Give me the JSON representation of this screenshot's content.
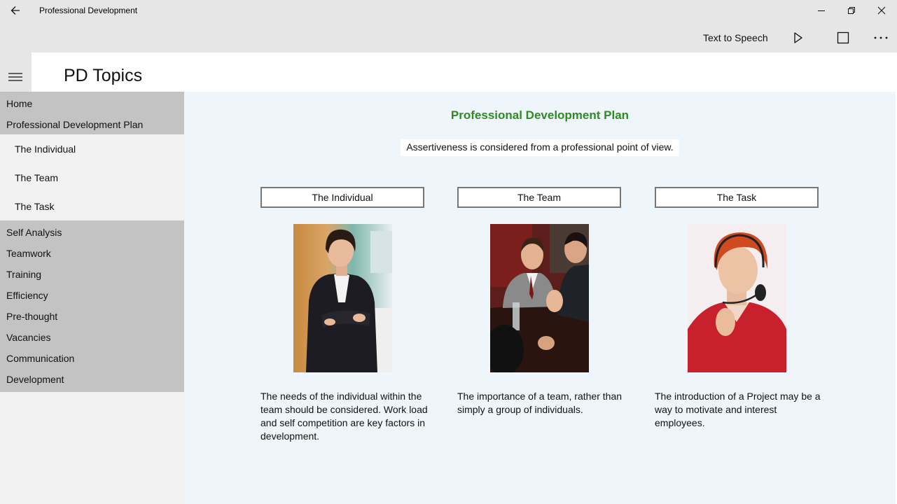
{
  "window": {
    "title": "Professional Development"
  },
  "commandbar": {
    "tts_label": "Text to Speech"
  },
  "header": {
    "page_title": "PD Topics"
  },
  "sidebar": {
    "top_items": [
      "Home",
      "Professional Development Plan"
    ],
    "sub_items": [
      "The Individual",
      "The Team",
      "The Task"
    ],
    "bottom_items": [
      "Self Analysis",
      "Teamwork",
      "Training",
      "Efficiency",
      "Pre-thought",
      "Vacancies",
      "Communication",
      "Development"
    ]
  },
  "main": {
    "title": "Professional Development Plan",
    "subtitle": "Assertiveness is considered from a professional point of view.",
    "topics": [
      {
        "button_label": "The Individual",
        "description": "The needs of the individual within the team should be considered. Work load and self competition are key factors in development."
      },
      {
        "button_label": "The Team",
        "description": "The importance of a team, rather than simply a group of individuals."
      },
      {
        "button_label": "The Task",
        "description": "The introduction of a Project may be a way to motivate and interest employees."
      }
    ]
  },
  "colors": {
    "title_green": "#2e8b22",
    "content_bg": "#eef6fc",
    "nav_group_bg": "#c3c3c3",
    "chrome_bg": "#e6e6e6"
  }
}
